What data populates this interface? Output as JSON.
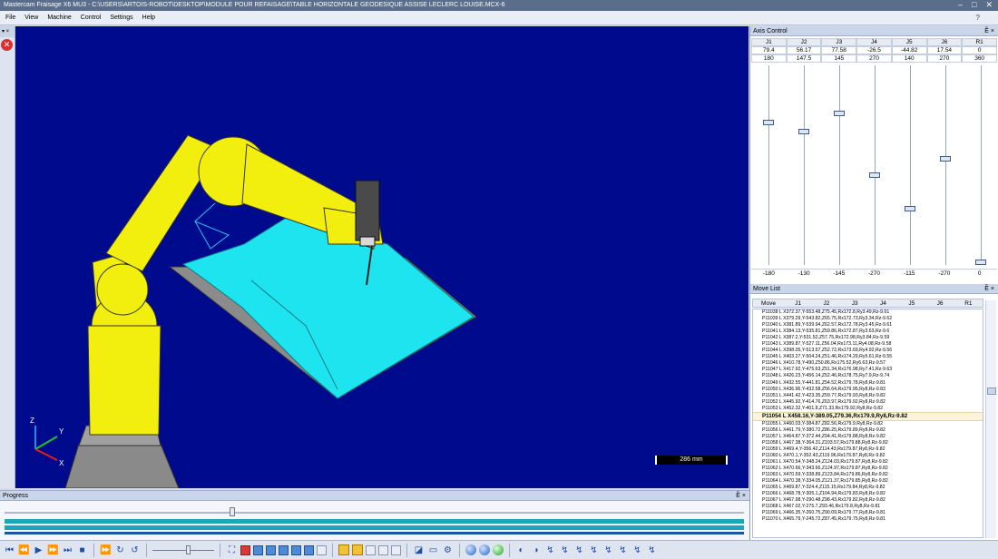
{
  "window": {
    "title": "Mastercam Fraisage X6 MU3 - C:\\USERS\\ARTOIS-ROBOT\\DESKTOP\\MODULE POUR REFAISAGE\\TABLE HORIZONTALE  GEODESIQUE ASSISE LECLERC LOUISE.MCX-6",
    "minimize": "‒",
    "maximize": "□",
    "close": "✕"
  },
  "menu": {
    "items": [
      "File",
      "View",
      "Machine",
      "Control",
      "Settings",
      "Help"
    ],
    "help_icon": "?"
  },
  "left_panel": {
    "header": "▾ ×"
  },
  "viewport": {
    "scale_label": "286 mm",
    "axes": {
      "z": "Z",
      "y": "Y",
      "x": "X"
    }
  },
  "axis_control": {
    "title": "Axis Control",
    "pin": "Ȅ ×",
    "headers": [
      "J1",
      "J2",
      "J3",
      "J4",
      "J5",
      "J6",
      "R1"
    ],
    "current": [
      "79.4",
      "56.17",
      "77.58",
      "-26.5",
      "-44.82",
      "17.54",
      "0"
    ],
    "max": [
      "180",
      "147.5",
      "145",
      "270",
      "140",
      "270",
      "360"
    ],
    "min": [
      "-180",
      "-130",
      "-145",
      "-270",
      "-115",
      "-270",
      "0"
    ]
  },
  "move_list": {
    "title": "Move List",
    "pin": "Ȅ ×",
    "headers": [
      "Move",
      "J1",
      "J2",
      "J3",
      "J4",
      "J5",
      "J6",
      "R1"
    ],
    "rows_before": [
      "P11038 L X372.37,Y-553.48,Z75.45,Rx172.8,Ry3.49,Rz-9.61",
      "P11039 L X379.29,Y-543.82,Z65.75,Rx172.73,Ry3.34,Rz-9.62",
      "P11040 L X381.89,Y-539.94,Z62.57,Rx172.78,Ry3.45,Rz-9.61",
      "P11041 L X384.13,Y-535.81,Z59.86,Rx172.87,Ry3.63,Rz-9.6",
      "P11042 L X387.2,Y-531.52,Z57.75,Rx172.98,Ry3.84,Rz-9.59",
      "P11043 L X389.87,Y-527.11,Z56.04,Rx173.11,Ry4.08,Rz-9.58",
      "P11044 L X398.05,Y-513.57,Z52.72,Rx173.69,Ry4.92,Rz-9.56",
      "P11045 L X403.27,Y-504.24,Z51.46,Rx174.29,Ry5.61,Rz-9.55",
      "P11046 L X410.78,Y-490,Z50.86,Rx175.52,Ry6.63,Rz-9.57",
      "P11047 L X417.92,Y-475.63,Z51.34,Rx176.98,Ry7.41,Rz-9.63",
      "P11048 L X426.23,Y-456.14,Z52.46,Rx178.75,Ry7.9,Rz-9.74",
      "P11049 L X432.55,Y-441.81,Z54.52,Rx179.78,Ry8,Rz-9.81",
      "P11050 L X436.96,Y-432.58,Z56.64,Rx179.95,Ry8,Rz-9.83",
      "P11051 L X441.42,Y-423.35,Z59.77,Rx179.93,Ry8,Rz-9.82",
      "P11052 L X445.92,Y-414.76,Z63.97,Rx179.92,Ry8,Rz-9.82",
      "P11053 L X452.32,Y-401.8,Z71.33,Rx179.92,Ry8,Rz-9.82"
    ],
    "current_row": "P11054 L X458.16,Y-389.05,Z79.36,Rx179.9,Ry8,Rz-9.82",
    "rows_after": [
      "P11055 L X460.03,Y-384.87,Z82.56,Rx179.9,Ry8,Rz-9.82",
      "P11056 L X461.79,Y-380.72,Z86.25,Rx179.89,Ry8,Rz-9.82",
      "P11057 L X464.87,Y-372.44,Z94.41,Rx179.88,Ry8,Rz-9.82",
      "P11058 L X467.38,Y-364.31,Z103.57,Rx179.88,Ry8,Rz-9.82",
      "P11059 L X469.4,Y-356.42,Z114.43,Rx179.87,Ry8,Rz-9.82",
      "P11060 L X470.1,Y-352.43,Z119.96,Rx179.87,Ry8,Rz-9.82",
      "P11061 L X470.54,Y-348.24,Z124.03,Rx179.87,Ry8,Rz-9.82",
      "P11062 L X470.66,Y-343.66,Z124.97,Rx179.87,Ry8,Rz-9.82",
      "P11063 L X470.59,Y-338.89,Z123.84,Rx179.86,Ry8,Rz-9.82",
      "P11064 L X470.38,Y-334.05,Z121.37,Rx179.85,Ry8,Rz-9.82",
      "P11065 L X469.87,Y-324.4,Z115.15,Rx179.84,Ry8,Rz-9.82",
      "P11066 L X468.78,Y-305.1,Z104.94,Rx179.83,Ry8,Rz-9.82",
      "P11067 L X467.98,Y-290.48,Z98.43,Rx179.82,Ry8,Rz-9.82",
      "P11068 L X467.02,Y-275.7,Z93.46,Rx179.8,Ry8,Rz-9.81",
      "P11069 L X466.35,Y-260.75,Z90.09,Rx179.77,Ry8,Rz-9.81",
      "P11070 L X465.79,Y-245.72,Z87.45,Rx179.75,Ry8,Rz-9.81"
    ]
  },
  "progress": {
    "title": "Progress",
    "pin": "Ȅ ×"
  },
  "toolbar": {
    "first": "⏮",
    "prev_frame": "⏪",
    "play": "▶",
    "next_frame": "⏩",
    "last": "⏭",
    "stop": "■",
    "fast": "⏩",
    "loop": "↻",
    "loop2": "↺"
  },
  "colors": {
    "viewport_bg": "#000a8c",
    "robot": "#f2ef0e",
    "workpiece": "#1de4ef",
    "fixture": "#8e8e8e"
  }
}
